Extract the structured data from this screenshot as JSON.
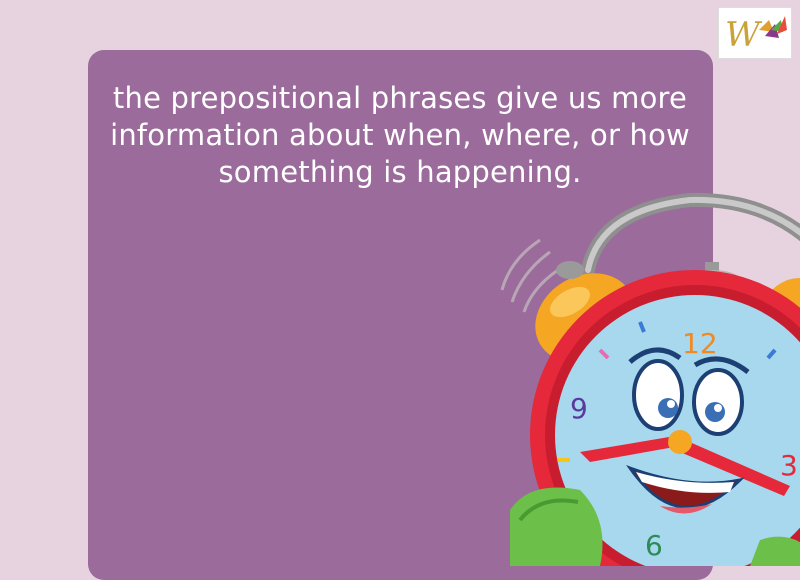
{
  "slide": {
    "text": "the prepositional phrases give us more information about when, where, or how something is happening."
  },
  "logo": {
    "letter": "W",
    "icon": "w-kite-logo"
  },
  "clock": {
    "icon": "cartoon-alarm-clock-icon",
    "numbers": {
      "twelve": "12",
      "nine": "9",
      "six": "6",
      "three": "3"
    }
  },
  "colors": {
    "background": "#e6d3df",
    "card": "#9a6b9b",
    "text": "#ffffff",
    "clock_rim": "#e5283a",
    "clock_face": "#a8d8ee",
    "bell": "#f5a623"
  }
}
